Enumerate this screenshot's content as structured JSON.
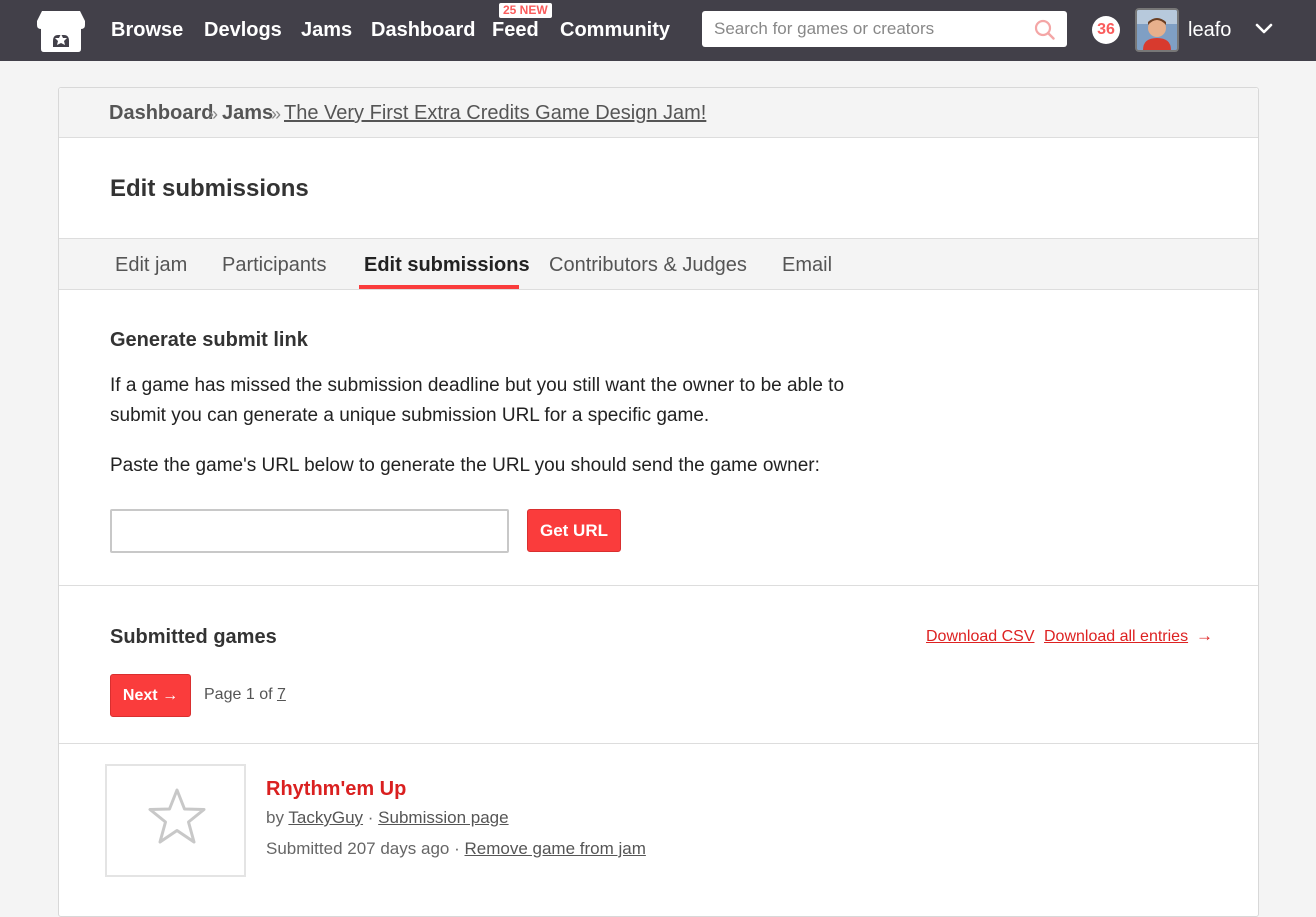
{
  "header": {
    "nav": [
      "Browse",
      "Devlogs",
      "Jams",
      "Dashboard",
      "Feed",
      "Community"
    ],
    "feed_badge": "25 NEW",
    "search_placeholder": "Search for games or creators",
    "notification_count": "36",
    "username": "leafo",
    "colors": {
      "bar": "#424049",
      "accent": "#fa5c5c"
    }
  },
  "breadcrumb": {
    "items": [
      "Dashboard",
      "Jams",
      "The Very First Extra Credits Game Design Jam!"
    ],
    "separator": "»"
  },
  "page_title": "Edit submissions",
  "tabs": {
    "items": [
      "Edit jam",
      "Participants",
      "Edit submissions",
      "Contributors & Judges",
      "Email"
    ],
    "active": "Edit submissions"
  },
  "generate": {
    "title": "Generate submit link",
    "desc_line1": "If a game has missed the submission deadline but you still want the owner to be able to",
    "desc_line2": "submit you can generate a unique submission URL for a specific game.",
    "instruction": "Paste the game's URL below to generate the URL you should send the game owner:",
    "input_value": "",
    "button": "Get URL"
  },
  "submitted": {
    "title": "Submitted games",
    "download_csv": "Download CSV",
    "download_all": "Download all entries",
    "next_button": "Next",
    "page_label": "Page",
    "page_current": "1",
    "page_of": "of",
    "page_total": "7"
  },
  "games": [
    {
      "title": "Rhythm'em Up",
      "by": "by",
      "author": "TackyGuy",
      "sep": "·",
      "submission_page": "Submission page",
      "submitted": "Submitted 207 days ago",
      "remove": "Remove game from jam"
    }
  ]
}
